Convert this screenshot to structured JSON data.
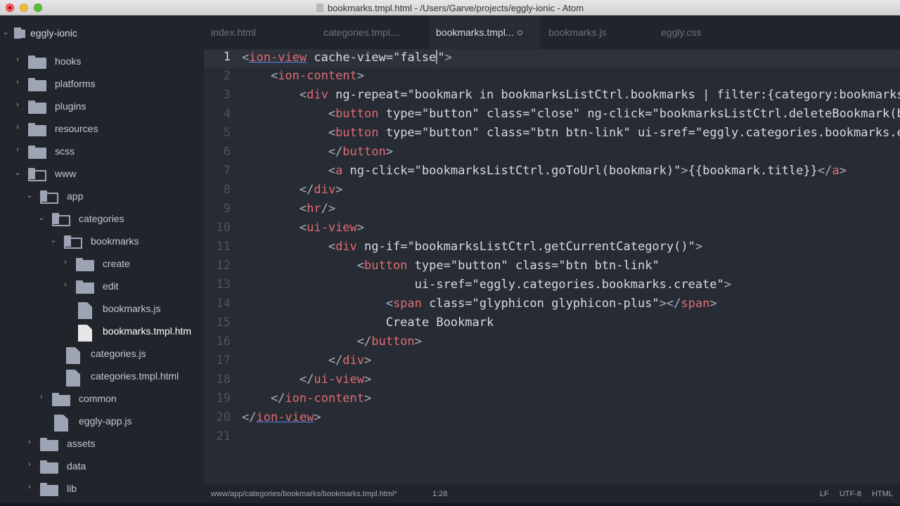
{
  "window": {
    "title": "bookmarks.tmpl.html - /Users/Garve/projects/eggly-ionic - Atom"
  },
  "sidebar": {
    "project": "eggly-ionic",
    "items": [
      {
        "label": "hooks"
      },
      {
        "label": "platforms"
      },
      {
        "label": "plugins"
      },
      {
        "label": "resources"
      },
      {
        "label": "scss"
      },
      {
        "label": "www"
      },
      {
        "label": "app"
      },
      {
        "label": "categories"
      },
      {
        "label": "bookmarks"
      },
      {
        "label": "create"
      },
      {
        "label": "edit"
      },
      {
        "label": "bookmarks.js"
      },
      {
        "label": "bookmarks.tmpl.htm"
      },
      {
        "label": "categories.js"
      },
      {
        "label": "categories.tmpl.html"
      },
      {
        "label": "common"
      },
      {
        "label": "eggly-app.js"
      },
      {
        "label": "assets"
      },
      {
        "label": "data"
      },
      {
        "label": "lib"
      }
    ]
  },
  "tabs": [
    {
      "label": "index.html"
    },
    {
      "label": "categories.tmpl...."
    },
    {
      "label": "bookmarks.tmpl..."
    },
    {
      "label": "bookmarks.js"
    },
    {
      "label": "eggly.css"
    }
  ],
  "editor": {
    "line_numbers": [
      "1",
      "2",
      "3",
      "4",
      "5",
      "6",
      "7",
      "8",
      "9",
      "10",
      "11",
      "12",
      "13",
      "14",
      "15",
      "16",
      "17",
      "18",
      "19",
      "20",
      "21"
    ],
    "current_line": 1,
    "lines": [
      {
        "segments": [
          [
            "p",
            "<"
          ],
          [
            "tg",
            "ion-view"
          ],
          [
            "at",
            " cache-view="
          ],
          [
            "st",
            "\"false"
          ],
          [
            "cursor",
            ""
          ],
          [
            "st",
            "\""
          ],
          [
            "p",
            ">"
          ]
        ]
      },
      {
        "segments": [
          [
            "p",
            "    <"
          ],
          [
            "tg",
            "ion-content"
          ],
          [
            "p",
            ">"
          ]
        ]
      },
      {
        "segments": [
          [
            "p",
            "        <"
          ],
          [
            "tg",
            "div"
          ],
          [
            "at",
            " ng-repeat="
          ],
          [
            "st",
            "\"bookmark in bookmarksListCtrl.bookmarks | filter:{category:bookmarksListCtrl.getCurrentCategoryName()}\""
          ],
          [
            "p",
            ">"
          ]
        ]
      },
      {
        "segments": [
          [
            "p",
            "            <"
          ],
          [
            "tg",
            "button"
          ],
          [
            "at",
            " type="
          ],
          [
            "st",
            "\"button\""
          ],
          [
            "at",
            " class="
          ],
          [
            "st",
            "\"close\""
          ],
          [
            "at",
            " ng-click="
          ],
          [
            "st",
            "\"bookmarksListCtrl.deleteBookmark(bookmark)\""
          ],
          [
            "p",
            ">"
          ]
        ]
      },
      {
        "segments": [
          [
            "p",
            "            <"
          ],
          [
            "tg",
            "button"
          ],
          [
            "at",
            " type="
          ],
          [
            "st",
            "\"button\""
          ],
          [
            "at",
            " class="
          ],
          [
            "st",
            "\"btn btn-link\""
          ],
          [
            "at",
            " ui-sref="
          ],
          [
            "st",
            "\"eggly.categories.bookmarks.edit\""
          ],
          [
            "p",
            ">"
          ]
        ]
      },
      {
        "segments": [
          [
            "p",
            "            </"
          ],
          [
            "tg",
            "button"
          ],
          [
            "p",
            ">"
          ]
        ]
      },
      {
        "segments": [
          [
            "p",
            "            <"
          ],
          [
            "tg",
            "a"
          ],
          [
            "at",
            " ng-click="
          ],
          [
            "st",
            "\"bookmarksListCtrl.goToUrl(bookmark)\""
          ],
          [
            "p",
            ">"
          ],
          [
            "at",
            "{{bookmark.title}}"
          ],
          [
            "p",
            "</"
          ],
          [
            "tg",
            "a"
          ],
          [
            "p",
            ">"
          ]
        ]
      },
      {
        "segments": [
          [
            "p",
            "        </"
          ],
          [
            "tg",
            "div"
          ],
          [
            "p",
            ">"
          ]
        ]
      },
      {
        "segments": [
          [
            "p",
            "        <"
          ],
          [
            "tg",
            "hr"
          ],
          [
            "p",
            "/>"
          ]
        ]
      },
      {
        "segments": [
          [
            "p",
            "        <"
          ],
          [
            "tg",
            "ui-view"
          ],
          [
            "p",
            ">"
          ]
        ]
      },
      {
        "segments": [
          [
            "p",
            "            <"
          ],
          [
            "tg",
            "div"
          ],
          [
            "at",
            " ng-if="
          ],
          [
            "st",
            "\"bookmarksListCtrl.getCurrentCategory()\""
          ],
          [
            "p",
            ">"
          ]
        ]
      },
      {
        "segments": [
          [
            "p",
            "                <"
          ],
          [
            "tg",
            "button"
          ],
          [
            "at",
            " type="
          ],
          [
            "st",
            "\"button\""
          ],
          [
            "at",
            " class="
          ],
          [
            "st",
            "\"btn btn-link\""
          ]
        ]
      },
      {
        "segments": [
          [
            "at",
            "                        ui-sref="
          ],
          [
            "st",
            "\"eggly.categories.bookmarks.create\""
          ],
          [
            "p",
            ">"
          ]
        ]
      },
      {
        "segments": [
          [
            "p",
            "                    <"
          ],
          [
            "tg",
            "span"
          ],
          [
            "at",
            " class="
          ],
          [
            "st",
            "\"glyphicon glyphicon-plus\""
          ],
          [
            "p",
            "></"
          ],
          [
            "tg",
            "span"
          ],
          [
            "p",
            ">"
          ]
        ]
      },
      {
        "segments": [
          [
            "at",
            "                    Create Bookmark"
          ]
        ]
      },
      {
        "segments": [
          [
            "p",
            "                </"
          ],
          [
            "tg",
            "button"
          ],
          [
            "p",
            ">"
          ]
        ]
      },
      {
        "segments": [
          [
            "p",
            "            </"
          ],
          [
            "tg",
            "div"
          ],
          [
            "p",
            ">"
          ]
        ]
      },
      {
        "segments": [
          [
            "p",
            "        </"
          ],
          [
            "tg",
            "ui-view"
          ],
          [
            "p",
            ">"
          ]
        ]
      },
      {
        "segments": [
          [
            "p",
            "    </"
          ],
          [
            "tg",
            "ion-content"
          ],
          [
            "p",
            ">"
          ]
        ]
      },
      {
        "segments": [
          [
            "p",
            "</"
          ],
          [
            "tg",
            "ion-view"
          ],
          [
            "p",
            ">"
          ]
        ]
      },
      {
        "segments": []
      }
    ]
  },
  "status": {
    "path": "www/app/categories/bookmarks/bookmarks.tmpl.html*",
    "cursor": "1:28",
    "line_ending": "LF",
    "encoding": "UTF-8",
    "grammar": "HTML"
  }
}
